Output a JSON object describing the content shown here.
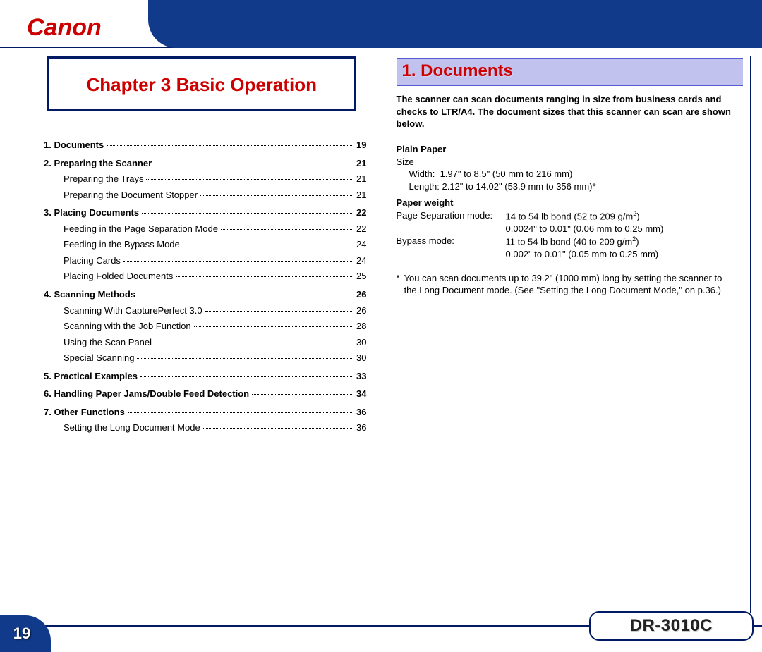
{
  "brand": "Canon",
  "chapter_title": "Chapter 3 Basic Operation",
  "toc": [
    {
      "n": "1.",
      "label": "Documents",
      "page": "19",
      "bold": true,
      "sub": false
    },
    {
      "n": "2.",
      "label": "Preparing the Scanner",
      "page": "21",
      "bold": true,
      "sub": false
    },
    {
      "n": "",
      "label": "Preparing the Trays",
      "page": "21",
      "bold": false,
      "sub": true
    },
    {
      "n": "",
      "label": "Preparing the Document Stopper",
      "page": "21",
      "bold": false,
      "sub": true
    },
    {
      "n": "3.",
      "label": "Placing Documents",
      "page": "22",
      "bold": true,
      "sub": false
    },
    {
      "n": "",
      "label": "Feeding in the Page Separation Mode",
      "page": "22",
      "bold": false,
      "sub": true
    },
    {
      "n": "",
      "label": "Feeding in the Bypass Mode",
      "page": "24",
      "bold": false,
      "sub": true
    },
    {
      "n": "",
      "label": "Placing Cards",
      "page": "24",
      "bold": false,
      "sub": true
    },
    {
      "n": "",
      "label": "Placing Folded Documents",
      "page": "25",
      "bold": false,
      "sub": true
    },
    {
      "n": "4.",
      "label": "Scanning Methods",
      "page": "26",
      "bold": true,
      "sub": false
    },
    {
      "n": "",
      "label": "Scanning With CapturePerfect 3.0",
      "page": "26",
      "bold": false,
      "sub": true
    },
    {
      "n": "",
      "label": "Scanning with the Job Function",
      "page": "28",
      "bold": false,
      "sub": true
    },
    {
      "n": "",
      "label": "Using the Scan Panel",
      "page": "30",
      "bold": false,
      "sub": true
    },
    {
      "n": "",
      "label": "Special Scanning",
      "page": "30",
      "bold": false,
      "sub": true
    },
    {
      "n": "5.",
      "label": "Practical Examples",
      "page": "33",
      "bold": true,
      "sub": false
    },
    {
      "n": "6.",
      "label": "Handling Paper Jams/Double Feed Detection",
      "page": "34",
      "bold": true,
      "sub": false
    },
    {
      "n": "7.",
      "label": "Other Functions",
      "page": "36",
      "bold": true,
      "sub": false
    },
    {
      "n": "",
      "label": "Setting the Long Document Mode",
      "page": "36",
      "bold": false,
      "sub": true
    }
  ],
  "section_title": "1. Documents",
  "intro": "The scanner can scan documents ranging in size from business cards and checks to LTR/A4. The document sizes that this scanner can scan are shown below.",
  "specs": {
    "plain_paper_head": "Plain Paper",
    "size_label": "Size",
    "width_label": "Width:",
    "width_value": "1.97\" to 8.5\" (50 mm to 216 mm)",
    "length_label": "Length:",
    "length_value": "2.12\" to 14.02\" (53.9 mm to 356 mm)*",
    "paper_weight_head": "Paper weight",
    "psm_label": "Page Separation mode:",
    "psm_value1a": "14 to 54 lb bond (52 to 209 g/m",
    "psm_value1b": ")",
    "psm_value2": "0.0024\" to 0.01\" (0.06 mm to 0.25 mm)",
    "bypass_label": "Bypass mode:",
    "bypass_value1a": "11 to 54 lb bond (40 to 209 g/m",
    "bypass_value1b": ")",
    "bypass_value2": "0.002\" to 0.01\" (0.05 mm to 0.25 mm)"
  },
  "footnote_star": "*",
  "footnote": "You can scan documents up to 39.2\" (1000 mm) long by setting the scanner to the Long Document mode. (See \"Setting the Long Document Mode,\" on p.36.)",
  "page_number": "19",
  "model": "DR-3010C"
}
